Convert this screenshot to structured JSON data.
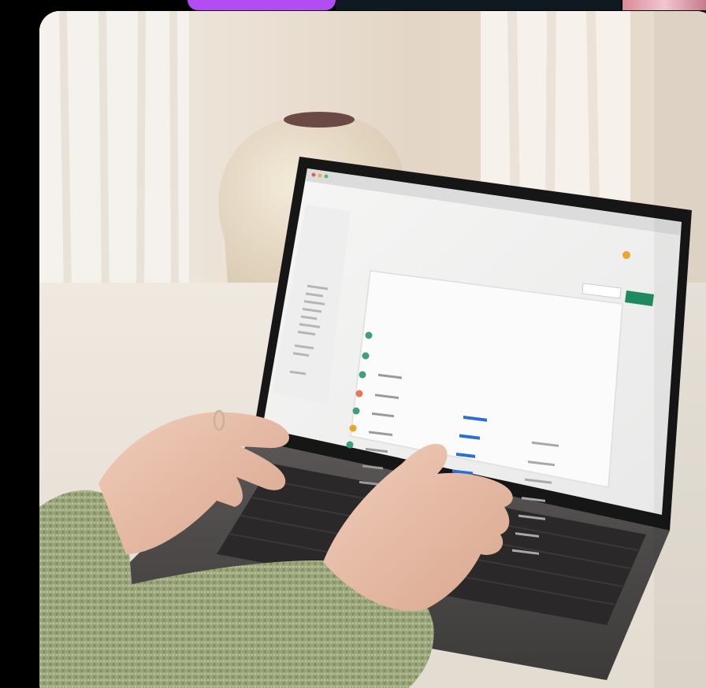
{
  "colors": {
    "accent_purple": "#b44cf5",
    "banner_dark": "#0e1a20",
    "admin_green": "#1f8a5f",
    "table_link_blue": "#2a6fd6"
  },
  "illustration": {
    "description_name": "person-typing-on-laptop-photo"
  }
}
